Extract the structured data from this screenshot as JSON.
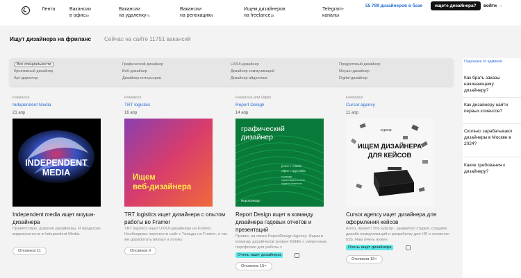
{
  "nav": {
    "items": [
      {
        "l1": "Лента",
        "l2": "",
        "sup": ""
      },
      {
        "l1": "Вакансии",
        "l2": "в офис",
        "sup": "30"
      },
      {
        "l1": "Вакансии",
        "l2": "на удаленку",
        "sup": "74"
      },
      {
        "l1": "Вакансии",
        "l2": "на релокацию",
        "sup": "0"
      },
      {
        "l1": "Ищем дизайнеров",
        "l2": "на freelance",
        "sup": "15"
      },
      {
        "l1": "Telegram-",
        "l2": "каналы",
        "sup": ""
      }
    ],
    "designers_count": "55 789 дизайнеров в базе",
    "cta": "ищете дизайнера?",
    "login": "войти"
  },
  "page": {
    "title": "Ищут дизайнера на фриланс",
    "subtitle": "Сейчас на сайте 11751 вакансий"
  },
  "filters": [
    [
      "Все специальности",
      "Креативный дизайнер",
      "Арт-директор"
    ],
    [
      "Графический дизайнер",
      "Веб-дизайнер",
      "Дизайнер интерьеров"
    ],
    [
      "UX/UI-дизайнер",
      "Дизайнер коммуникаций",
      "Дизайнер айдентики"
    ],
    [
      "Продуктовый дизайнер",
      "Моушн-дизайнер",
      "Digital-дизайнер"
    ]
  ],
  "cards": [
    {
      "type": "Freelance",
      "company": "Independent Media",
      "date": "21 апр",
      "title": "Independent media ищет моушн-дизайнера",
      "desc": "Приветствую, дорогие дизайнеры. Я продюсер видеоконтента в Independent Media.",
      "badge": "",
      "responses": "Откликов 11",
      "img_text": [
        "INDEPENDENT",
        "MEDIA"
      ]
    },
    {
      "type": "Freelance",
      "company": "TRT logistics",
      "date": "16 апр",
      "title": "TRT logistics ищет дизайнера с опытом работы во Framer",
      "desc": "TRT logistics ищет UX/UI-дизайнера на Framer. Необходимо перенести сайт с Тильды на Framer, а так же доработать визуал и логику",
      "badge": "",
      "responses": "Откликов 9",
      "img_text": [
        "Ищем",
        "веб-дизайнера"
      ]
    },
    {
      "type": "Freelance или Офис",
      "company": "Report Design",
      "date": "14 апр",
      "title": "Report Design ищет в команду дизайнера годовых отчетов и презентаций",
      "desc": "Привет, на связи ReportDesign Agency. Ищем в команду дизайнеров уровня Middle с уверенным портфолио для работы с",
      "badge": "Очень ищет дизайнера",
      "responses": "Откликов 15+",
      "img_text": [
        "графический",
        "дизайнер",
        "junior + middle",
        "офис + фултайм",
        "в команду",
        "презентаций и отчетов",
        "годового отчетности",
        "ReportDesign"
      ]
    },
    {
      "type": "Freelance",
      "company": "Cursor.agency",
      "date": "11 апр",
      "title": "Cursor.agency ищет дизайнера для оформления кейсов",
      "desc": "Алло, привет! Это курсор - диджитал студия, создаём дизайн коммуникаций и разработку для HR и сложного b2b. Нам очень нужен",
      "badge": "Очень ищет дизайнера",
      "responses": "Откликов 15+",
      "img_text": [
        "курсор",
        "ИЩЕМ ДИЗАЙНЕРА",
        "ДЛЯ КЕЙСОВ"
      ]
    }
  ],
  "sidebar": {
    "head": "Подсказки от админов",
    "items": [
      "Как брать заказы начинающему дизайнеру?",
      "Как дизайнеру найти первых клиентов?",
      "Сколько зарабатывают дизайнеры в Москве в 2024?",
      "Какие требования к дизайнеру?"
    ]
  },
  "colors": {
    "accent": "#2a6fd6",
    "badge": "#5ee8e8",
    "band": "#f3f3f3"
  }
}
